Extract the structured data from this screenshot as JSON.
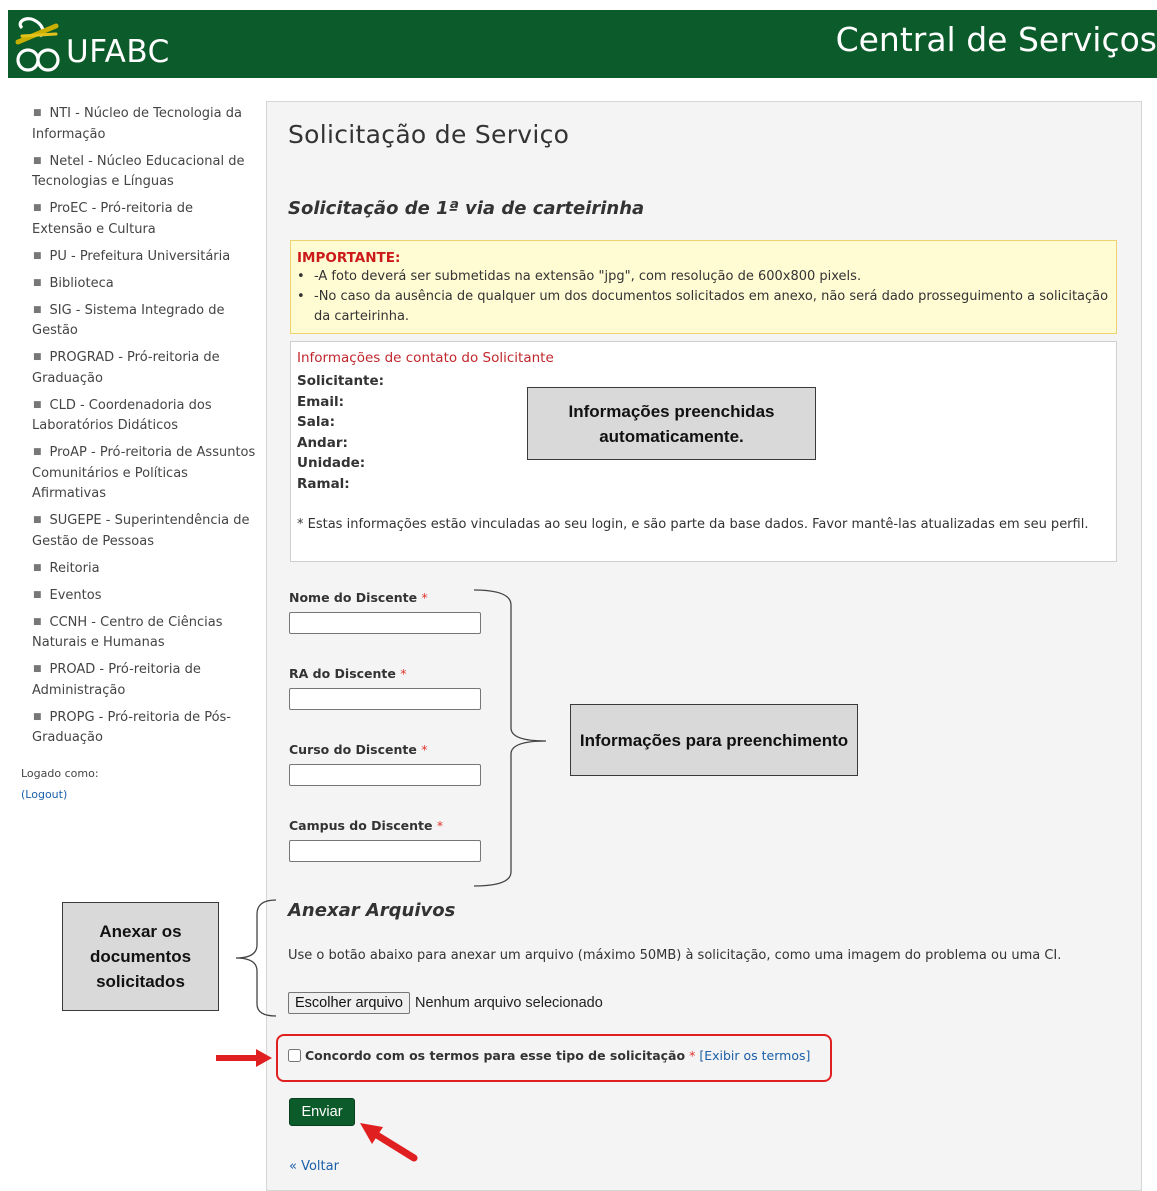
{
  "header": {
    "logo_text": "UFABC",
    "title": "Central de Serviços"
  },
  "sidebar": {
    "items": [
      {
        "label": "NTI - Núcleo de Tecnologia da Informação"
      },
      {
        "label": "Netel - Núcleo Educacional de Tecnologias e Línguas"
      },
      {
        "label": "ProEC - Pró-reitoria de Extensão e Cultura"
      },
      {
        "label": "PU - Prefeitura Universitária"
      },
      {
        "label": "Biblioteca"
      },
      {
        "label": "SIG - Sistema Integrado de Gestão"
      },
      {
        "label": "PROGRAD - Pró-reitoria de Graduação"
      },
      {
        "label": "CLD - Coordenadoria dos Laboratórios Didáticos"
      },
      {
        "label": "ProAP - Pró-reitoria de Assuntos Comunitários e Políticas Afirmativas"
      },
      {
        "label": "SUGEPE - Superintendência de Gestão de Pessoas"
      },
      {
        "label": "Reitoria"
      },
      {
        "label": "Eventos"
      },
      {
        "label": "CCNH - Centro de Ciências Naturais e Humanas"
      },
      {
        "label": "PROAD - Pró-reitoria de Administração"
      },
      {
        "label": "PROPG - Pró-reitoria de Pós-Graduação"
      }
    ],
    "logged_as": "Logado como:",
    "logout": "(Logout)"
  },
  "main": {
    "title": "Solicitação de Serviço",
    "subtitle": "Solicitação de 1ª via de carteirinha",
    "important": {
      "title": "IMPORTANTE:",
      "bullet": "•",
      "line1": "-A foto deverá ser submetidas na extensão \"jpg\", com resolução de 600x800 pixels.",
      "line2": "-No caso da ausência de qualquer um dos documentos solicitados em anexo, não será dado prosseguimento a solicitação da carteirinha."
    },
    "contact": {
      "title": "Informações de contato do Solicitante",
      "labels": [
        "Solicitante:",
        "Email:",
        "Sala:",
        "Andar:",
        "Unidade:",
        "Ramal:"
      ],
      "note": "* Estas informações estão vinculadas ao seu login, e são parte da base dados. Favor mantê-las atualizadas em seu perfil."
    },
    "fields": [
      {
        "label": "Nome do Discente",
        "required": "*"
      },
      {
        "label": "RA do Discente",
        "required": "*"
      },
      {
        "label": "Curso do Discente",
        "required": "*"
      },
      {
        "label": "Campus do Discente",
        "required": "*"
      }
    ],
    "attach": {
      "title": "Anexar Arquivos",
      "description": "Use o botão abaixo para anexar um arquivo (máximo 50MB) à solicitação, como uma imagem do problema ou uma CI.",
      "button": "Escolher arquivo",
      "status": "Nenhum arquivo selecionado"
    },
    "terms": {
      "label": "Concordo com os termos para esse tipo de solicitação",
      "required": "*",
      "link": "[Exibir os termos]"
    },
    "submit": "Enviar",
    "back": "« Voltar"
  },
  "annotations": {
    "auto": "Informações preenchidas automaticamente.",
    "fill": "Informações para preenchimento",
    "attach": "Anexar os documentos solicitados"
  },
  "colors": {
    "brand_green": "#0c5b2a",
    "required_red": "#e0332d",
    "annotation_red": "#e02020",
    "link_blue": "#1a5fa8"
  }
}
